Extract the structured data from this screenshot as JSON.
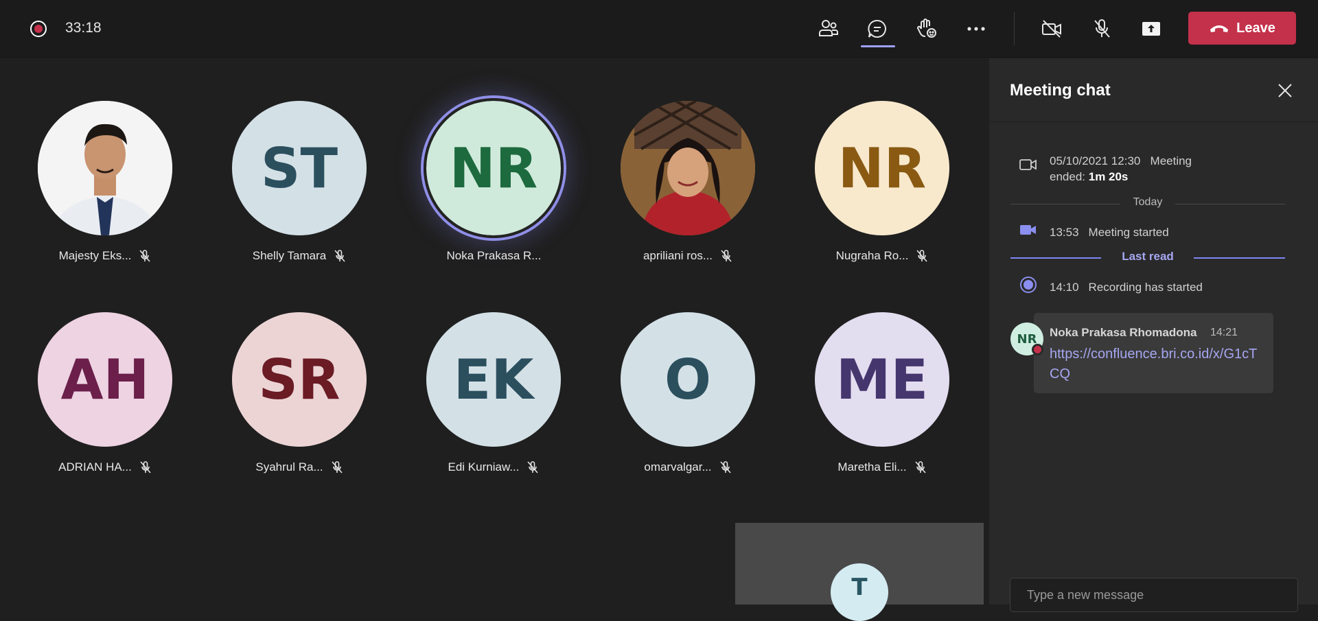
{
  "topbar": {
    "timer": "33:18",
    "leave_label": "Leave"
  },
  "participants": [
    {
      "name": "Majesty Eks...",
      "initials": "",
      "photo": true,
      "muted": true,
      "bg": "#ffffff",
      "fg": "#000000"
    },
    {
      "name": "Shelly Tamara",
      "initials": "ST",
      "photo": false,
      "muted": true,
      "bg": "#d3e1e7",
      "fg": "#2c4f5e"
    },
    {
      "name": "Noka Prakasa R...",
      "initials": "NR",
      "photo": false,
      "muted": false,
      "speaking": true,
      "bg": "#cfeadb",
      "fg": "#1d6a3e"
    },
    {
      "name": "apriliani ros...",
      "initials": "",
      "photo": true,
      "muted": true,
      "bg": "#a07448",
      "fg": "#000000"
    },
    {
      "name": "Nugraha Ro...",
      "initials": "NR",
      "photo": false,
      "muted": true,
      "bg": "#f8e9cd",
      "fg": "#8a5a13"
    },
    {
      "name": "ADRIAN HA...",
      "initials": "AH",
      "photo": false,
      "muted": true,
      "bg": "#eed3e2",
      "fg": "#6b1f4a"
    },
    {
      "name": "Syahrul Ra...",
      "initials": "SR",
      "photo": false,
      "muted": true,
      "bg": "#ecd4d5",
      "fg": "#6a1b24"
    },
    {
      "name": "Edi Kurniaw...",
      "initials": "EK",
      "photo": false,
      "muted": true,
      "bg": "#d3e1e7",
      "fg": "#2c4f5e"
    },
    {
      "name": "omarvalgar...",
      "initials": "O",
      "photo": false,
      "muted": true,
      "bg": "#d3e1e7",
      "fg": "#2c4f5e"
    },
    {
      "name": "Maretha Eli...",
      "initials": "ME",
      "photo": false,
      "muted": true,
      "bg": "#e3ddf0",
      "fg": "#46366e"
    }
  ],
  "self_tile": {
    "initials": "T"
  },
  "chat": {
    "title": "Meeting chat",
    "events": {
      "meeting_ended_time": "05/10/2021 12:30",
      "meeting_ended_text": "Meeting",
      "meeting_ended_prefix": "ended:",
      "meeting_ended_duration": "1m 20s",
      "today_label": "Today",
      "meeting_started_time": "13:53",
      "meeting_started_text": "Meeting started",
      "last_read_label": "Last read",
      "recording_time": "14:10",
      "recording_text": "Recording has started"
    },
    "message": {
      "avatar_initials": "NR",
      "sender": "Noka Prakasa Rhomadona",
      "time": "14:21",
      "link": "https://confluence.bri.co.id/x/G1cTCQ"
    },
    "composer_placeholder": "Type a new message"
  },
  "colors": {
    "accent": "#7f85f5",
    "leave": "#c4314b",
    "recording": "#c4314b"
  }
}
